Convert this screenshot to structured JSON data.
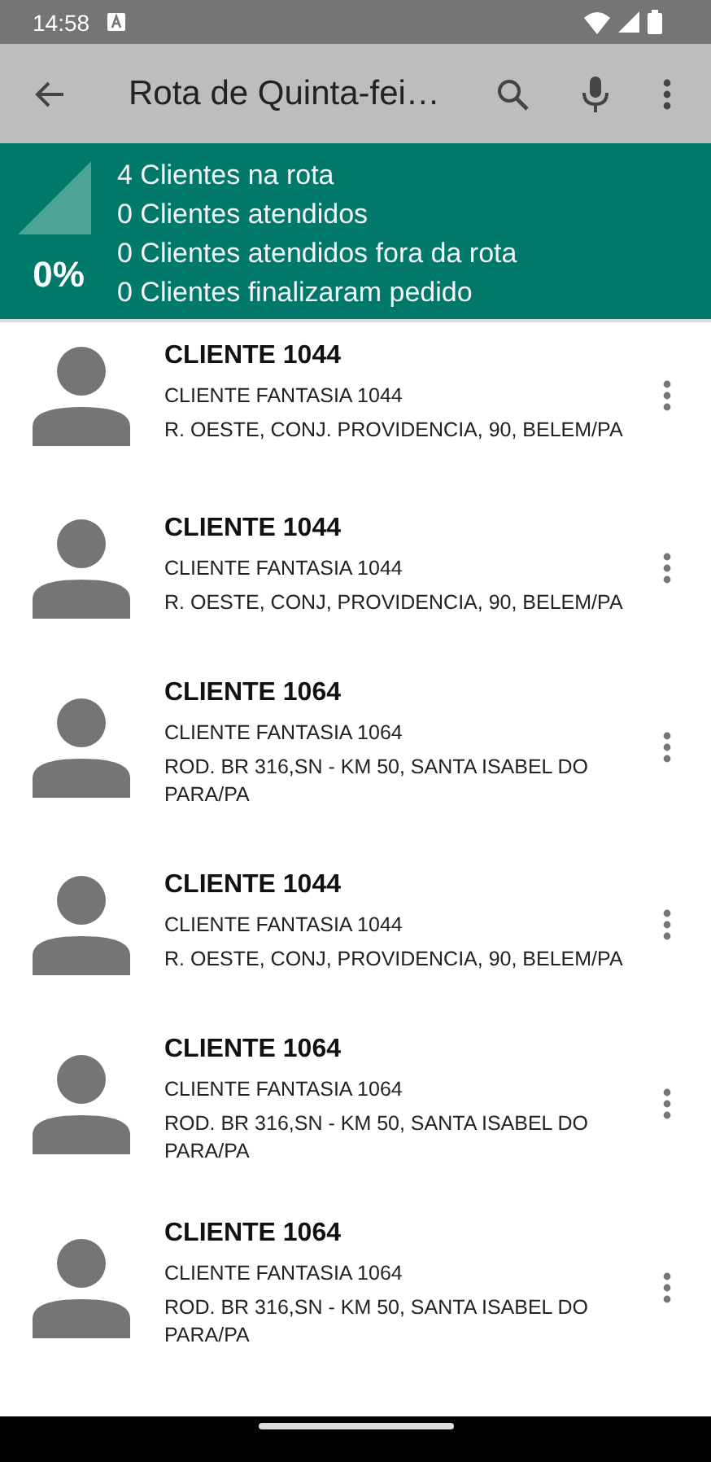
{
  "status_bar": {
    "time": "14:58"
  },
  "toolbar": {
    "title": "Rota de Quinta-fei…"
  },
  "summary": {
    "percent": "0%",
    "lines": [
      "4 Clientes na rota",
      "0 Clientes atendidos",
      "0 Clientes atendidos fora da rota",
      "0 Clientes finalizaram pedido"
    ]
  },
  "clients": [
    {
      "name": "CLIENTE 1044",
      "trade_name": "CLIENTE FANTASIA 1044",
      "address": "R. OESTE, CONJ. PROVIDENCIA, 90, BELEM/PA"
    },
    {
      "name": "CLIENTE 1044",
      "trade_name": "CLIENTE FANTASIA 1044",
      "address": "R. OESTE, CONJ, PROVIDENCIA, 90, BELEM/PA"
    },
    {
      "name": "CLIENTE 1064",
      "trade_name": "CLIENTE FANTASIA 1064",
      "address": "ROD. BR 316,SN - KM 50, SANTA ISABEL DO PARA/PA"
    },
    {
      "name": "CLIENTE 1044",
      "trade_name": "CLIENTE FANTASIA 1044",
      "address": "R. OESTE, CONJ, PROVIDENCIA, 90, BELEM/PA"
    },
    {
      "name": "CLIENTE 1064",
      "trade_name": "CLIENTE FANTASIA 1064",
      "address": "ROD. BR 316,SN - KM 50, SANTA ISABEL DO PARA/PA"
    },
    {
      "name": "CLIENTE 1064",
      "trade_name": "CLIENTE FANTASIA 1064",
      "address": "ROD. BR 316,SN - KM 50, SANTA ISABEL DO PARA/PA"
    }
  ]
}
